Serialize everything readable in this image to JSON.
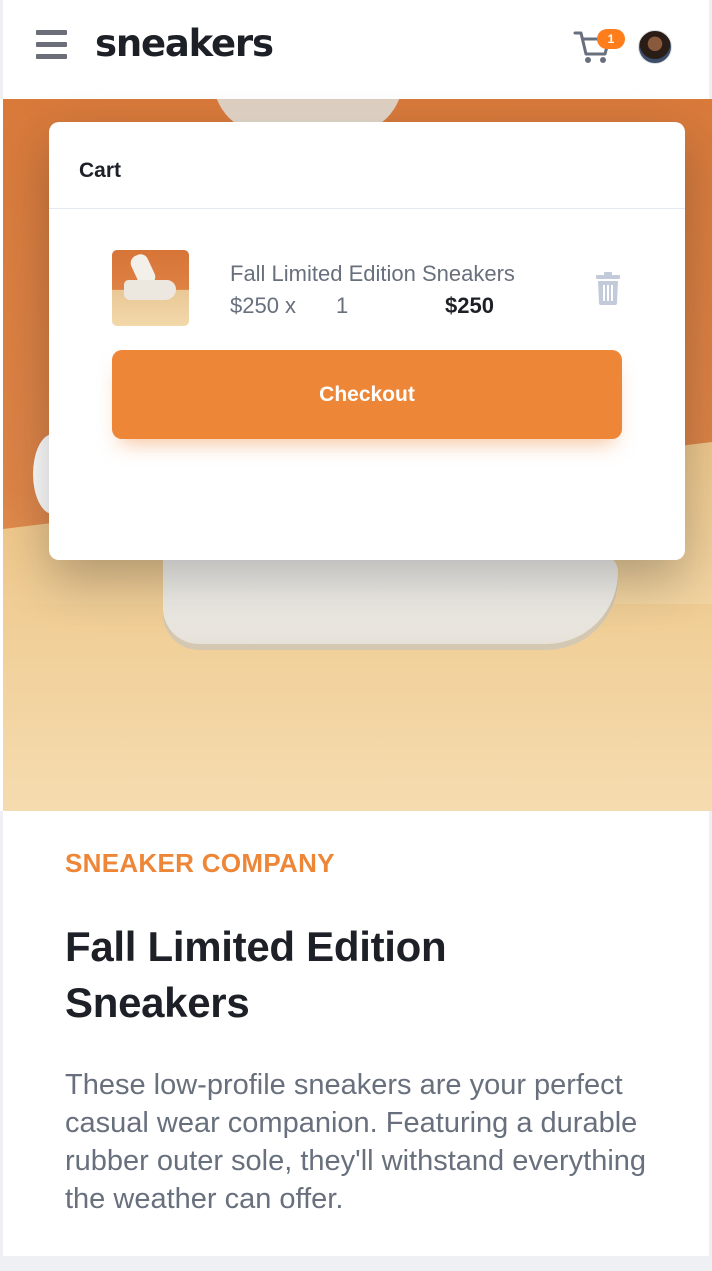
{
  "header": {
    "logo": "sneakers",
    "cart_badge": "1"
  },
  "cart": {
    "title": "Cart",
    "item": {
      "name": "Fall Limited Edition Sneakers",
      "price": "$250 x",
      "quantity": "1",
      "total": "$250"
    },
    "checkout_label": "Checkout"
  },
  "product": {
    "company": "SNEAKER COMPANY",
    "title": "Fall Limited Edition Sneakers",
    "description": "These low-profile sneakers are your perfect casual wear companion. Featuring a durable rubber outer sole, they'll withstand everything the weather can offer."
  },
  "colors": {
    "accent": "#ee8638",
    "dark_text": "#1d2026",
    "muted_text": "#68707d"
  },
  "icons": [
    "menu-icon",
    "cart-icon",
    "avatar",
    "trash-icon"
  ]
}
